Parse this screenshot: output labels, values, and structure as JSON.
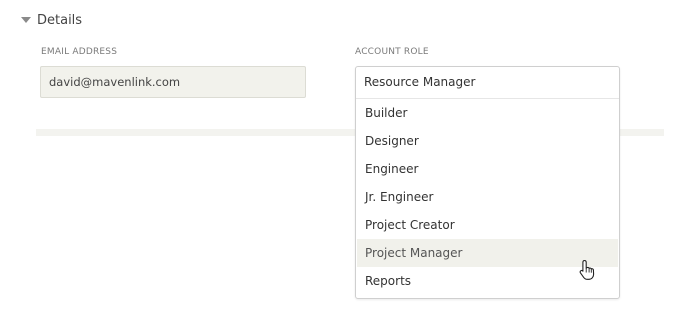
{
  "section": {
    "title": "Details",
    "icon": "caret-down-icon"
  },
  "email": {
    "label": "EMAIL ADDRESS",
    "value": "david@mavenlink.com"
  },
  "role": {
    "label": "ACCOUNT ROLE",
    "selected": "Resource Manager",
    "options": [
      "Builder",
      "Designer",
      "Engineer",
      "Jr. Engineer",
      "Project Creator",
      "Project Manager",
      "Reports"
    ],
    "hovered_option": "Project Manager"
  },
  "cursor": {
    "icon": "hand-pointer-icon"
  },
  "colors": {
    "input_bg": "#f2f2ec",
    "hover_bg": "#f1f1eb",
    "border": "#cfcfcf"
  }
}
